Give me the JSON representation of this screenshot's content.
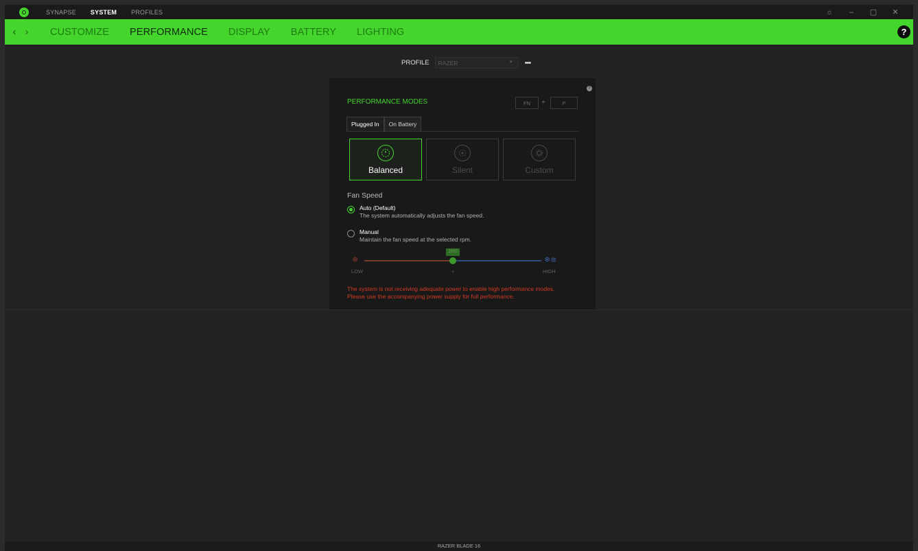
{
  "topnav": {
    "items": [
      {
        "label": "SYNAPSE",
        "active": false
      },
      {
        "label": "SYSTEM",
        "active": true
      },
      {
        "label": "PROFILES",
        "active": false
      }
    ]
  },
  "window_controls": {
    "settings_icon": "gear-icon",
    "minimize_icon": "minimize-icon",
    "maximize_icon": "maximize-icon",
    "close_icon": "close-icon",
    "settings": "☼",
    "minimize": "–",
    "maximize": "▢",
    "close": "✕"
  },
  "subnav": {
    "back": "‹",
    "forward": "›",
    "items": [
      {
        "label": "CUSTOMIZE",
        "active": false
      },
      {
        "label": "PERFORMANCE",
        "active": true
      },
      {
        "label": "DISPLAY",
        "active": false
      },
      {
        "label": "BATTERY",
        "active": false
      },
      {
        "label": "LIGHTING",
        "active": false
      }
    ],
    "help": "?"
  },
  "profile": {
    "label": "PROFILE",
    "value": "RAZER",
    "more": "•••"
  },
  "performance": {
    "title": "PERFORMANCE MODES",
    "shortcut": {
      "key1": "FN",
      "plus": "+",
      "key2": "P"
    },
    "tabs": [
      {
        "label": "Plugged In",
        "active": true
      },
      {
        "label": "On Battery",
        "active": false
      }
    ],
    "modes": [
      {
        "label": "Balanced",
        "icon": "speedometer-icon",
        "active": true
      },
      {
        "label": "Silent",
        "icon": "fan-icon",
        "active": false
      },
      {
        "label": "Custom",
        "icon": "gear-icon",
        "active": false
      }
    ],
    "fan_speed": {
      "title": "Fan Speed",
      "options": [
        {
          "label": "Auto (Default)",
          "desc": "The system automatically adjusts the fan speed.",
          "selected": true
        },
        {
          "label": "Manual",
          "desc": "Maintain the fan speed at the selected rpm.",
          "selected": false
        }
      ],
      "slider": {
        "bubble": "2500",
        "low": "LOW",
        "high": "HIGH",
        "mid": "+"
      }
    },
    "warning": [
      "The system is not receiving adequate power to enable high performance modes.",
      "Please use the accompanying power supply for full performance."
    ]
  },
  "footer": {
    "device": "RAZER BLADE 16"
  },
  "colors": {
    "accent": "#44d62c",
    "warning": "#d13a22",
    "background": "#222222"
  }
}
